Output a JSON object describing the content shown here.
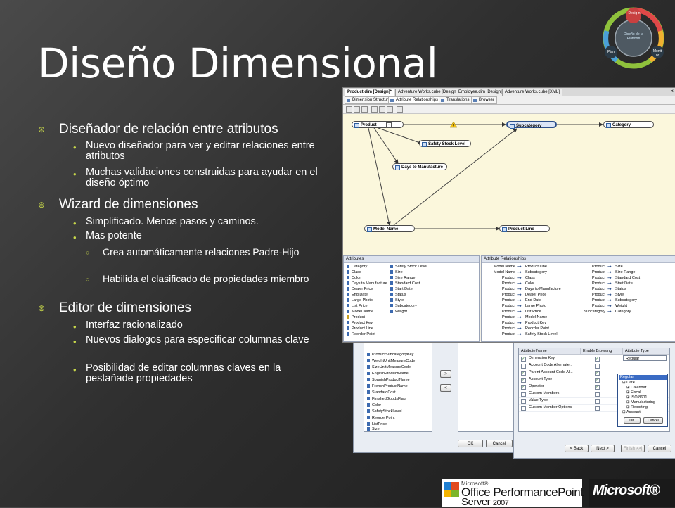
{
  "slide": {
    "title": "Diseño Dimensional",
    "bullets": {
      "b1": "Diseñador de relación entre atributos",
      "b1_1": "Nuevo diseñador para ver y editar relaciones entre atributos",
      "b1_2": "Muchas validaciones construidas para ayudar en el diseño óptimo",
      "b2": "Wizard de dimensiones",
      "b2_1": "Simplificado.  Menos pasos y caminos.",
      "b2_2": "Mas potente",
      "b2_2_1": "Crea automáticamente relaciones Padre-Hijo",
      "b2_2_2": "Habilida el clasificado de propiedades miembro",
      "b3": "Editor de dimensiones",
      "b3_1": "Interfaz racionalizado",
      "b3_2": "Nuevos dialogos para especificar columnas clave",
      "b3_3": "Posibilidad de editar columnas claves en la pestañade propiedades"
    },
    "colors": {
      "accent": "#c8d84a",
      "background": "#333333",
      "text": "#ffffff"
    }
  },
  "logo": {
    "top": "Desig n",
    "center": "Diseño de la Platform",
    "left": "Plan",
    "right": "Monit or"
  },
  "window": {
    "tabs": [
      "Product.dim [Design]*",
      "Adventure Works.cube [Design]",
      "Employee.dim [Design]",
      "Adventure Works.cube [XML]"
    ],
    "subtabs": [
      "Dimension Structure",
      "Attribute Relationships",
      "Translations",
      "Browser"
    ],
    "nodes": {
      "product": "Product",
      "subcategory": "Subcategory",
      "category": "Category",
      "safety": "Safety Stock Level",
      "days": "Days to Manufacture",
      "model": "Model Name",
      "line": "Product Line"
    },
    "attributes_header": "Attributes",
    "relationships_header": "Attribute Relationships",
    "attributes_col1": [
      "Category",
      "Class",
      "Color",
      "Days to Manufacture",
      "Dealer Price",
      "End Date",
      "Large Photo",
      "List Price",
      "Model Name",
      "Product",
      "Product Key",
      "Product Line",
      "Reorder Point"
    ],
    "attributes_col2": [
      "Safety Stock Level",
      "Size",
      "Size Range",
      "Standard Cost",
      "Start Date",
      "Status",
      "Style",
      "Subcategory",
      "Weight"
    ],
    "relationships_col1": [
      [
        "Model Name",
        "Product Line"
      ],
      [
        "Model Name",
        "Subcategory"
      ],
      [
        "Product",
        "Class"
      ],
      [
        "Product",
        "Color"
      ],
      [
        "Product",
        "Days to Manufacture"
      ],
      [
        "Product",
        "Dealer Price"
      ],
      [
        "Product",
        "End Date"
      ],
      [
        "Product",
        "Large Photo"
      ],
      [
        "Product",
        "List Price"
      ],
      [
        "Product",
        "Model Name"
      ],
      [
        "Product",
        "Product Key"
      ],
      [
        "Product",
        "Reorder Point"
      ],
      [
        "Product",
        "Safety Stock Level"
      ]
    ],
    "relationships_col2": [
      [
        "Product",
        "Size"
      ],
      [
        "Product",
        "Size Range"
      ],
      [
        "Product",
        "Standard Cost"
      ],
      [
        "Product",
        "Start Date"
      ],
      [
        "Product",
        "Status"
      ],
      [
        "Product",
        "Style"
      ],
      [
        "Product",
        "Subcategory"
      ],
      [
        "Product",
        "Weight"
      ],
      [
        "Subcategory",
        "Category"
      ]
    ]
  },
  "dialogA": {
    "columns": [
      "ProductSubcategoryKey",
      "WeightUnitMeasureCode",
      "SizeUnitMeasureCode",
      "EnglishProductName",
      "SpanishProductName",
      "FrenchProductName",
      "StandardCost",
      "FinishedGoodsFlag",
      "Color",
      "SafetyStockLevel",
      "ReorderPoint",
      "ListPrice",
      "Size"
    ],
    "move_right": ">",
    "move_left": "<",
    "ok": "OK",
    "cancel": "Cancel"
  },
  "dialogB": {
    "headers": [
      "Attribute Name",
      "Enable Browsing",
      "Attribute Type"
    ],
    "rows": [
      "Dimension Key",
      "Account Code Alternate...",
      "Parent Account Code Al...",
      "Account Type",
      "Operator",
      "Custom Members",
      "Value Type",
      "Custom Member Options"
    ],
    "attribute_type": "Regular",
    "dropdown": [
      "Regular",
      "Date",
      "Calendar",
      "Fiscal",
      "ISO 8601",
      "Manufacturing",
      "Reporting",
      "Account"
    ],
    "dd_ok": "OK",
    "dd_cancel": "Cancel",
    "back": "< Back",
    "next": "Next >",
    "finish": "Finish >>|",
    "cancel": "Cancel"
  },
  "footer": {
    "office_line1": "Microsoft®",
    "office_line2": "Office PerformancePoint",
    "office_line3": "Server",
    "office_year": "2007",
    "microsoft": "Microsoft®"
  }
}
